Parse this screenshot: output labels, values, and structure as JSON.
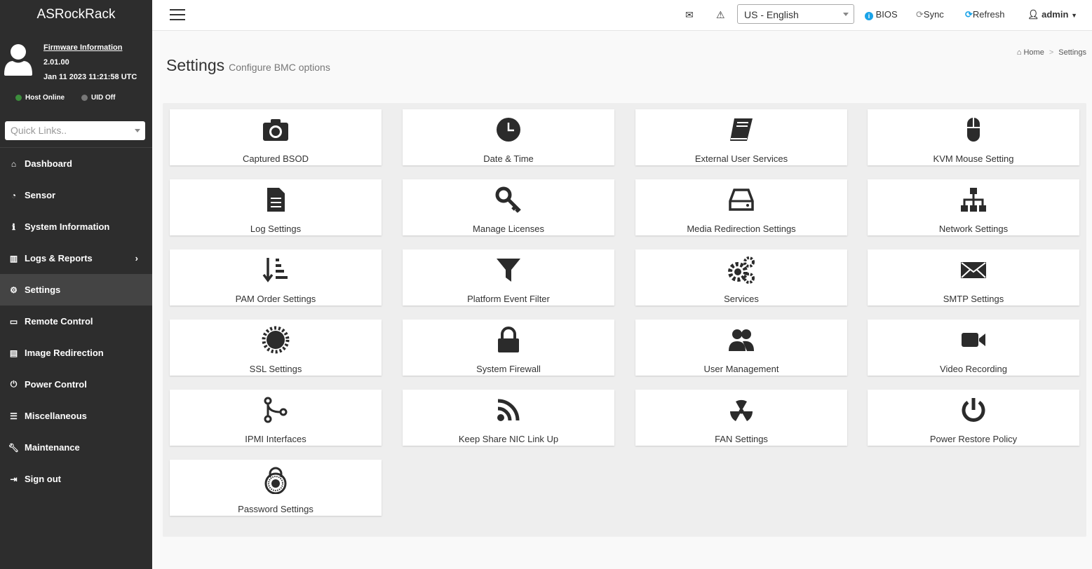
{
  "brand": "ASRockRack",
  "firmware": {
    "link": "Firmware Information",
    "version": "2.01.00",
    "date": "Jan 11 2023 11:21:58 UTC"
  },
  "status": {
    "host": "Host Online",
    "uid": "UID Off",
    "host_color": "#3c8d3c",
    "uid_color": "#777777"
  },
  "quick_links": {
    "placeholder": "Quick Links.."
  },
  "nav": [
    {
      "label": "Dashboard",
      "icon": "home-icon"
    },
    {
      "label": "Sensor",
      "icon": "gauge-icon"
    },
    {
      "label": "System Information",
      "icon": "info-icon"
    },
    {
      "label": "Logs & Reports",
      "icon": "bar-chart-icon"
    },
    {
      "label": "Settings",
      "icon": "gear-icon"
    },
    {
      "label": "Remote Control",
      "icon": "monitor-icon"
    },
    {
      "label": "Image Redirection",
      "icon": "drive-icon"
    },
    {
      "label": "Power Control",
      "icon": "power-icon"
    },
    {
      "label": "Miscellaneous",
      "icon": "list-icon"
    },
    {
      "label": "Maintenance",
      "icon": "wrench-icon"
    },
    {
      "label": "Sign out",
      "icon": "sign-out-icon"
    }
  ],
  "topbar": {
    "language": "US - English",
    "bios": "BIOS",
    "sync": "Sync",
    "refresh": "Refresh",
    "user": "admin"
  },
  "page": {
    "title": "Settings",
    "subtitle": "Configure BMC options"
  },
  "breadcrumb": {
    "home": "Home",
    "current": "Settings"
  },
  "tiles": [
    {
      "label": "Captured BSOD",
      "icon": "camera-icon"
    },
    {
      "label": "Date & Time",
      "icon": "clock-icon"
    },
    {
      "label": "External User Services",
      "icon": "book-icon"
    },
    {
      "label": "KVM Mouse Setting",
      "icon": "mouse-icon"
    },
    {
      "label": "Log Settings",
      "icon": "file-icon"
    },
    {
      "label": "Manage Licenses",
      "icon": "key-icon"
    },
    {
      "label": "Media Redirection Settings",
      "icon": "hdd-icon"
    },
    {
      "label": "Network Settings",
      "icon": "sitemap-icon"
    },
    {
      "label": "PAM Order Settings",
      "icon": "sort-icon"
    },
    {
      "label": "Platform Event Filter",
      "icon": "filter-icon"
    },
    {
      "label": "Services",
      "icon": "gears-icon"
    },
    {
      "label": "SMTP Settings",
      "icon": "envelope-icon"
    },
    {
      "label": "SSL Settings",
      "icon": "certificate-icon"
    },
    {
      "label": "System Firewall",
      "icon": "lock-icon"
    },
    {
      "label": "User Management",
      "icon": "users-icon"
    },
    {
      "label": "Video Recording",
      "icon": "video-camera-icon"
    },
    {
      "label": "IPMI Interfaces",
      "icon": "branch-icon"
    },
    {
      "label": "Keep Share NIC Link Up",
      "icon": "rss-icon"
    },
    {
      "label": "FAN Settings",
      "icon": "radiation-icon"
    },
    {
      "label": "Power Restore Policy",
      "icon": "power-icon"
    },
    {
      "label": "Password Settings",
      "icon": "combination-lock-icon"
    }
  ]
}
